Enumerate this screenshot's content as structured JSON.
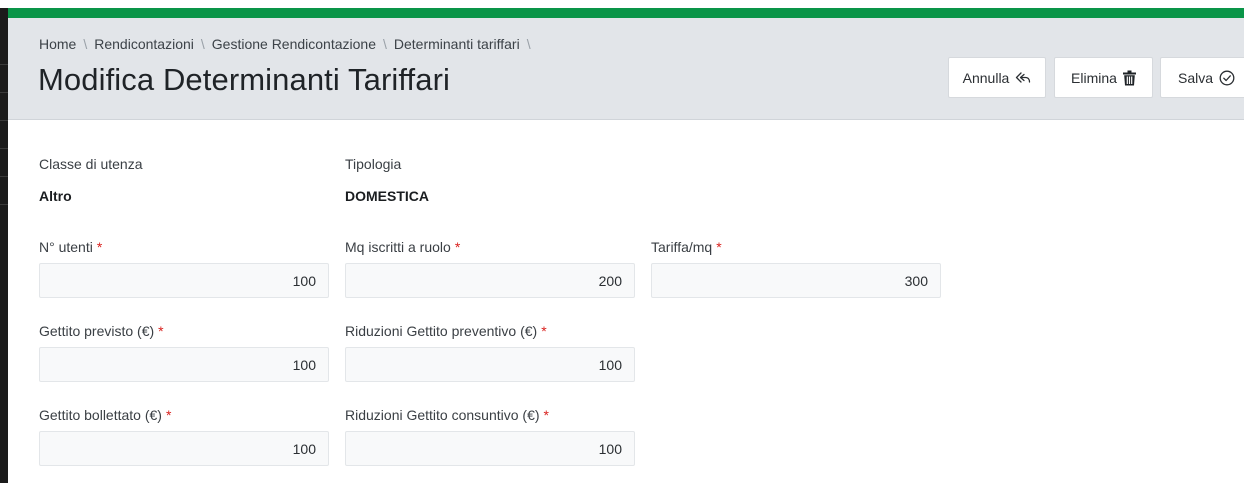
{
  "breadcrumb": {
    "items": [
      "Home",
      "Rendicontazioni",
      "Gestione Rendicontazione",
      "Determinanti tariffari"
    ],
    "separator": "\\"
  },
  "page": {
    "title": "Modifica Determinanti Tariffari"
  },
  "actions": {
    "annulla_label": "Annulla",
    "elimina_label": "Elimina",
    "salva_label": "Salva"
  },
  "info": {
    "classe_label": "Classe di utenza",
    "classe_value": "Altro",
    "tipologia_label": "Tipologia",
    "tipologia_value": "DOMESTICA"
  },
  "fields": {
    "n_utenti": {
      "label": "N° utenti",
      "value": "100"
    },
    "mq_iscritti": {
      "label": "Mq iscritti a ruolo",
      "value": "200"
    },
    "tariffa_mq": {
      "label": "Tariffa/mq",
      "value": "300"
    },
    "gettito_previsto": {
      "label": "Gettito previsto (€)",
      "value": "100"
    },
    "riduzioni_preventivo": {
      "label": "Riduzioni Gettito preventivo (€)",
      "value": "100"
    },
    "gettito_bollettato": {
      "label": "Gettito bollettato (€)",
      "value": "100"
    },
    "riduzioni_consuntivo": {
      "label": "Riduzioni Gettito consuntivo (€)",
      "value": "100"
    }
  },
  "required_marker": "*",
  "colors": {
    "accent_green": "#0a9548",
    "header_bg": "#e2e5e9",
    "required_red": "#d9211e",
    "side_strip": "#1b1b1b"
  },
  "icons": {
    "annulla": "reply-arrow-icon",
    "elimina": "trash-icon",
    "salva": "check-circle-icon"
  }
}
